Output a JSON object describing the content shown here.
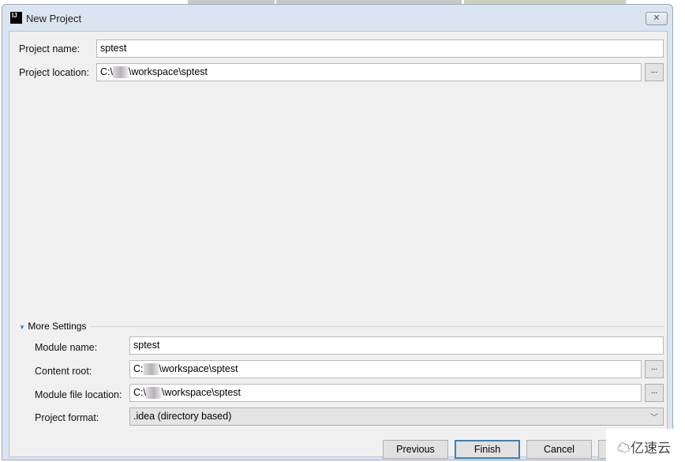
{
  "window": {
    "title": "New Project",
    "app_icon": "IJ",
    "close_icon": "close-icon"
  },
  "project": {
    "name_label": "Project name:",
    "name_value": "sptest",
    "location_label": "Project location:",
    "location_prefix": "C:\\",
    "location_suffix": "\\workspace\\sptest",
    "browse_label": "..."
  },
  "more_settings": {
    "label": "More Settings",
    "expanded": true,
    "module_name_label": "Module name:",
    "module_name_value": "sptest",
    "content_root_label": "Content root:",
    "content_root_prefix": "C:",
    "content_root_suffix": "\\workspace\\sptest",
    "module_file_label": "Module file location:",
    "module_file_prefix": "C:\\",
    "module_file_suffix": "\\workspace\\sptest",
    "format_label": "Project format:",
    "format_value": ".idea (directory based)",
    "browse_label": "..."
  },
  "buttons": {
    "previous": "Previous",
    "finish": "Finish",
    "cancel": "Cancel"
  },
  "watermark": "亿速云"
}
